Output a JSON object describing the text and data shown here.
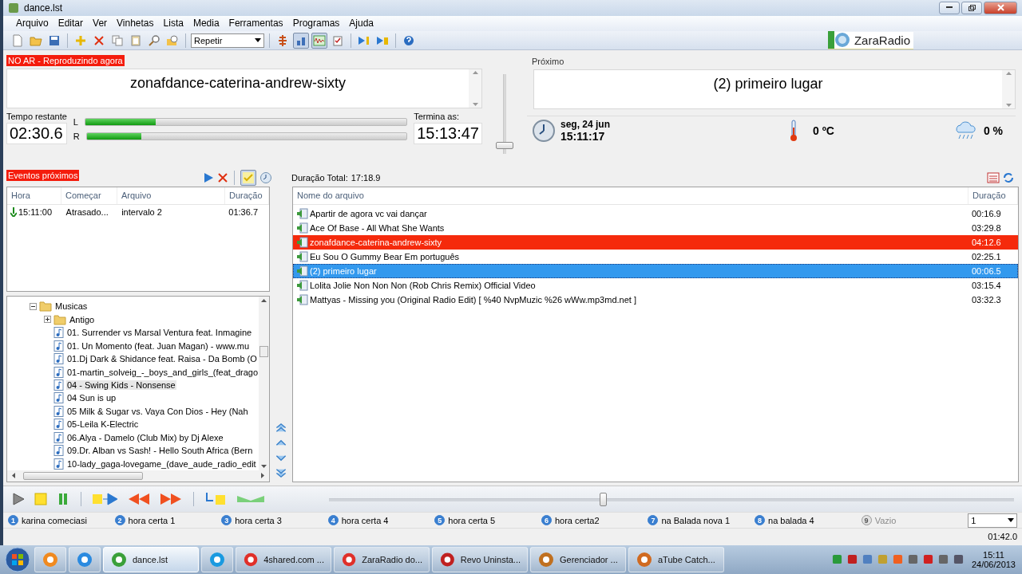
{
  "window": {
    "title": "dance.lst"
  },
  "menu": [
    "Arquivo",
    "Editar",
    "Ver",
    "Vinhetas",
    "Lista",
    "Media",
    "Ferramentas",
    "Programas",
    "Ajuda"
  ],
  "toolbar": {
    "mode": "Repetir",
    "toggles": [
      {
        "pressed": false
      },
      {
        "pressed": true
      },
      {
        "pressed": true
      },
      {
        "pressed": false
      }
    ],
    "brand": "ZaraRadio"
  },
  "on_air": {
    "label": "NO AR - Reproduzindo agora",
    "title": "zonafdance-caterina-andrew-sixty",
    "remaining_label": "Tempo restante",
    "remaining": "02:30.6",
    "meters": [
      {
        "channel": "L",
        "level": 0.22
      },
      {
        "channel": "R",
        "level": 0.17
      }
    ],
    "ends_label": "Termina as:",
    "ends": "15:13:47"
  },
  "volume": {
    "level": 0.1
  },
  "next": {
    "label": "Próximo",
    "title": "(2) primeiro lugar"
  },
  "clock": {
    "date": "seg, 24 jun",
    "time": "15:11:17"
  },
  "weather": {
    "temperature": "0 ºC",
    "rain": "0 %"
  },
  "events": {
    "label": "Eventos próximos",
    "toggle_pressed": true,
    "columns": [
      "Hora",
      "Começar",
      "Arquivo",
      "Duração"
    ],
    "rows": [
      {
        "hora": "15:11:00",
        "comecar": "Atrasado...",
        "arquivo": "intervalo 2",
        "duracao": "01:36.7"
      }
    ]
  },
  "total": {
    "label": "Duração Total:",
    "value": "17:18.9"
  },
  "tree": [
    {
      "label": "Musicas",
      "kind": "folder",
      "expanded": true,
      "children": [
        {
          "label": "Antigo",
          "kind": "folder",
          "expanded": false
        },
        {
          "label": "01. Surrender vs Marsal Ventura feat. Inmagine",
          "kind": "file",
          "selected": false
        },
        {
          "label": "01. Un Momento (feat. Juan Magan) - www.mu",
          "kind": "file",
          "selected": false
        },
        {
          "label": "01.Dj Dark & Shidance feat. Raisa - Da Bomb (O",
          "kind": "file",
          "selected": false
        },
        {
          "label": "01-martin_solveig_-_boys_and_girls_(feat_drago",
          "kind": "file",
          "selected": false
        },
        {
          "label": "04 - Swing Kids - Nonsense",
          "kind": "file",
          "selected": true
        },
        {
          "label": "04 Sun is up",
          "kind": "file",
          "selected": false
        },
        {
          "label": "05 Milk & Sugar vs. Vaya Con Dios - Hey (Nah",
          "kind": "file",
          "selected": false
        },
        {
          "label": "05-Leila K-Electric",
          "kind": "file",
          "selected": false
        },
        {
          "label": "06.Alya - Damelo (Club Mix) by Dj Alexe",
          "kind": "file",
          "selected": false
        },
        {
          "label": "09.Dr. Alban vs Sash! - Hello South Africa (Bern",
          "kind": "file",
          "selected": false
        },
        {
          "label": "10-lady_gaga-lovegame_(dave_aude_radio_edit",
          "kind": "file",
          "selected": false
        }
      ]
    }
  ],
  "playlist": {
    "columns": [
      "Nome do arquivo",
      "Duração"
    ],
    "rows": [
      {
        "name": "Apartir de agora vc vai dançar",
        "duration": "00:16.9",
        "playing": false,
        "selected": false
      },
      {
        "name": "Ace Of Base - All What She Wants",
        "duration": "03:29.8",
        "playing": false,
        "selected": false
      },
      {
        "name": "zonafdance-caterina-andrew-sixty",
        "duration": "04:12.6",
        "playing": true,
        "selected": false
      },
      {
        "name": "Eu Sou O Gummy Bear  Em português",
        "duration": "02:25.1",
        "playing": false,
        "selected": false
      },
      {
        "name": "(2) primeiro lugar",
        "duration": "00:06.5",
        "playing": false,
        "selected": true
      },
      {
        "name": "Lolita Jolie   Non Non Non (Rob  Chris Remix) Official Video",
        "duration": "03:15.4",
        "playing": false,
        "selected": false
      },
      {
        "name": "Mattyas - Missing you (Original Radio Edit) [ %40 NvpMuzic %26 wWw.mp3md.net ]",
        "duration": "03:32.3",
        "playing": false,
        "selected": false
      }
    ]
  },
  "transport": {
    "position": {
      "level": 0.4
    }
  },
  "hotkeys": [
    {
      "number": "1",
      "label": "karina comeciasi",
      "empty": false
    },
    {
      "number": "2",
      "label": "hora certa 1",
      "empty": false
    },
    {
      "number": "3",
      "label": "hora certa 3",
      "empty": false
    },
    {
      "number": "4",
      "label": "hora certa 4",
      "empty": false
    },
    {
      "number": "5",
      "label": "hora certa 5",
      "empty": false
    },
    {
      "number": "6",
      "label": "hora certa2",
      "empty": false
    },
    {
      "number": "7",
      "label": "na Balada nova 1",
      "empty": false
    },
    {
      "number": "8",
      "label": "na balada 4",
      "empty": false
    },
    {
      "number": "9",
      "label": "Vazio",
      "empty": true
    }
  ],
  "hotkey_page": "1",
  "status": {
    "time": "01:42.0"
  },
  "taskbar": {
    "items": [
      {
        "active": false
      },
      {
        "active": false
      },
      {
        "label": "dance.lst",
        "active": true
      },
      {
        "active": false
      },
      {
        "label": "4shared.com ...",
        "active": false
      },
      {
        "label": "ZaraRadio do...",
        "active": false
      },
      {
        "label": "Revo Uninsta...",
        "active": false
      },
      {
        "label": "Gerenciador ...",
        "active": false
      },
      {
        "label": "aTube Catch...",
        "active": false
      }
    ],
    "time": "15:11",
    "date": "24/06/2013"
  }
}
